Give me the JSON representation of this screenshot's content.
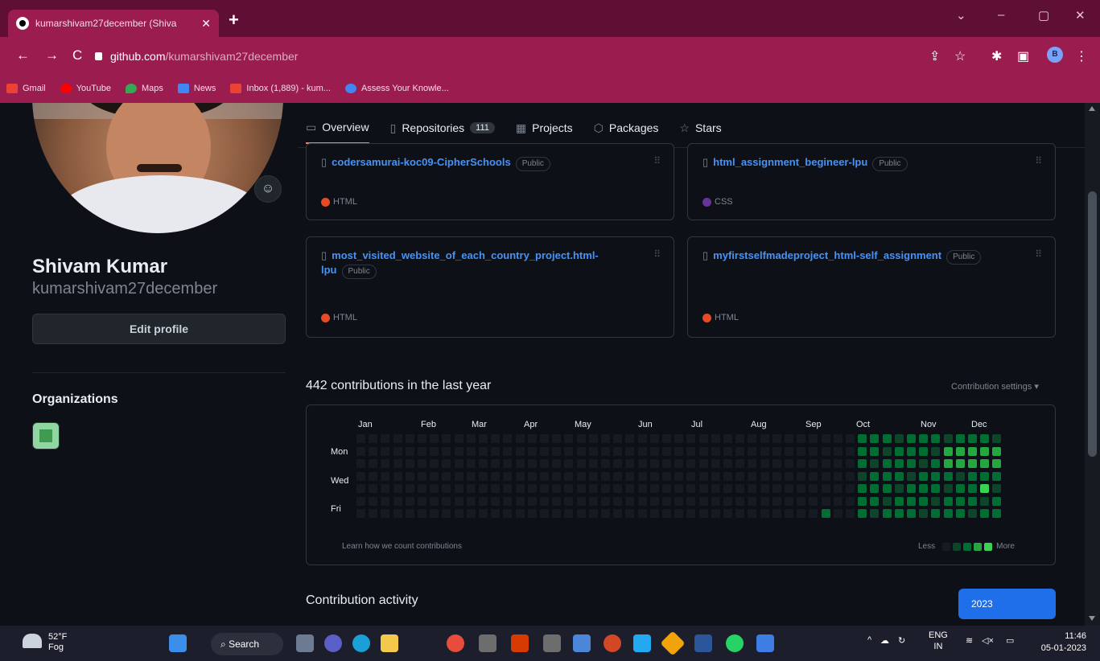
{
  "browser": {
    "tab_title": "kumarshivam27december (Shiva",
    "tab_close": "✕",
    "new_tab": "+",
    "url_domain": "github.com",
    "url_path": "/kumarshivam27december",
    "window_controls": [
      "⌄",
      "–",
      "▢",
      "✕"
    ],
    "bookmarks": [
      {
        "label": "Gmail",
        "color": "#ea4335"
      },
      {
        "label": "YouTube",
        "color": "#ff0000"
      },
      {
        "label": "Maps",
        "color": "#34a853"
      },
      {
        "label": "News",
        "color": "#4285f4"
      },
      {
        "label": "Inbox (1,889) - kum...",
        "color": "#ea4335"
      },
      {
        "label": "Assess Your Knowle...",
        "color": "#4285f4"
      }
    ],
    "profile_initial": "B"
  },
  "profile": {
    "name": "Shivam Kumar",
    "login": "kumarshivam27december",
    "edit_button": "Edit profile",
    "organizations_title": "Organizations"
  },
  "tabs": {
    "overview": "Overview",
    "repositories": "Repositories",
    "repositories_count": "111",
    "projects": "Projects",
    "packages": "Packages",
    "stars": "Stars"
  },
  "repos": [
    {
      "name": "codersamurai-koc09-CipherSchools",
      "badge": "Public",
      "language": "HTML",
      "lang_color": "#e34c26"
    },
    {
      "name": "html_assignment_begineer-lpu",
      "badge": "Public",
      "language": "CSS",
      "lang_color": "#663399"
    },
    {
      "name": "most_visited_website_of_each_country_project.html-lpu",
      "badge": "Public",
      "language": "HTML",
      "lang_color": "#e34c26"
    },
    {
      "name": "myfirstselfmadeproject_html-self_assignment",
      "badge": "Public",
      "language": "HTML",
      "lang_color": "#e34c26"
    }
  ],
  "contributions": {
    "title": "442 contributions in the last year",
    "settings": "Contribution settings ▾",
    "months": [
      "Jan",
      "Feb",
      "Mar",
      "Apr",
      "May",
      "Jun",
      "Jul",
      "Aug",
      "Sep",
      "Oct",
      "Nov",
      "Dec"
    ],
    "days": [
      "Mon",
      "Wed",
      "Fri"
    ],
    "learn_link": "Learn how we count contributions",
    "legend_less": "Less",
    "legend_more": "More",
    "colors": [
      "#161b22",
      "#0e4429",
      "#006d32",
      "#26a641",
      "#39d353"
    ]
  },
  "activity": {
    "title": "Contribution activity",
    "year": "2023"
  },
  "taskbar": {
    "temp": "52°F",
    "condition": "Fog",
    "search": "Search",
    "lang": "ENG",
    "region": "IN",
    "time": "11:46",
    "date": "05-01-2023"
  }
}
